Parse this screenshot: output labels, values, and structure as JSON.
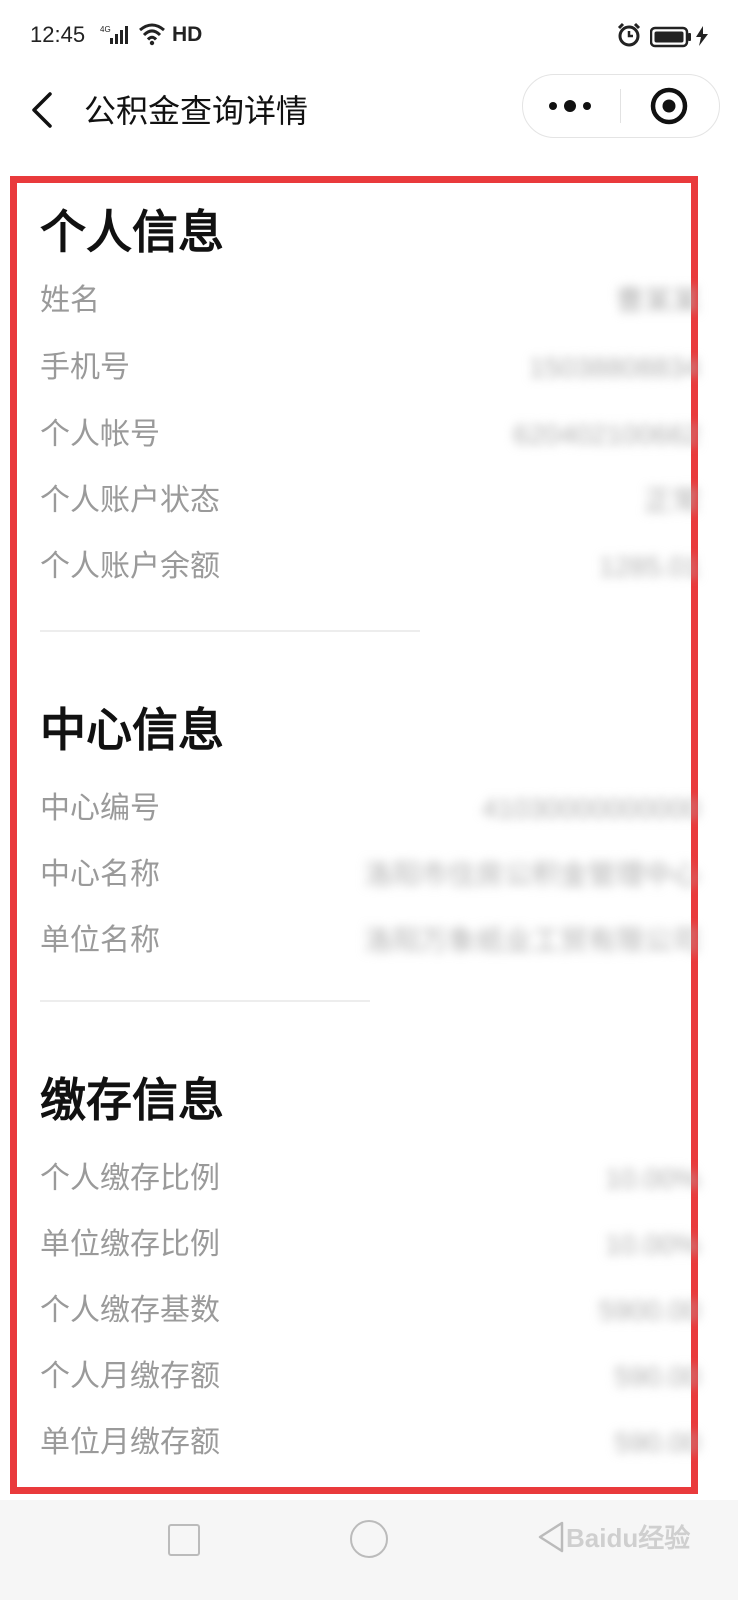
{
  "status_bar": {
    "time": "12:45",
    "network": "4G",
    "hd": "HD",
    "icons": [
      "signal-icon",
      "wifi-icon",
      "alarm-icon",
      "battery-icon",
      "charging-icon"
    ]
  },
  "nav": {
    "title": "公积金查询详情",
    "back_icon": "chevron-left-icon",
    "more_icon": "more-dots-icon",
    "close_icon": "target-circle-icon"
  },
  "sections": [
    {
      "title": "个人信息",
      "rows": [
        {
          "label": "姓名",
          "value": "曹某某"
        },
        {
          "label": "手机号",
          "value": "15038808834"
        },
        {
          "label": "个人帐号",
          "value": "620402100662"
        },
        {
          "label": "个人账户状态",
          "value": "正常"
        },
        {
          "label": "个人账户余额",
          "value": "1285.01"
        }
      ]
    },
    {
      "title": "中心信息",
      "rows": [
        {
          "label": "中心编号",
          "value": "41030000000000"
        },
        {
          "label": "中心名称",
          "value": "洛阳市住房公积金管理中心"
        },
        {
          "label": "单位名称",
          "value": "洛阳万象纸业工贸有限公司"
        }
      ]
    },
    {
      "title": "缴存信息",
      "rows": [
        {
          "label": "个人缴存比例",
          "value": "10.00%"
        },
        {
          "label": "单位缴存比例",
          "value": "10.00%"
        },
        {
          "label": "个人缴存基数",
          "value": "5900.00"
        },
        {
          "label": "个人月缴存额",
          "value": "590.00"
        },
        {
          "label": "单位月缴存额",
          "value": "590.00"
        }
      ]
    }
  ],
  "watermark": "Baidu经验",
  "colors": {
    "highlight_border": "#e93a3c",
    "label": "#9a9a9a",
    "title": "#111111"
  }
}
